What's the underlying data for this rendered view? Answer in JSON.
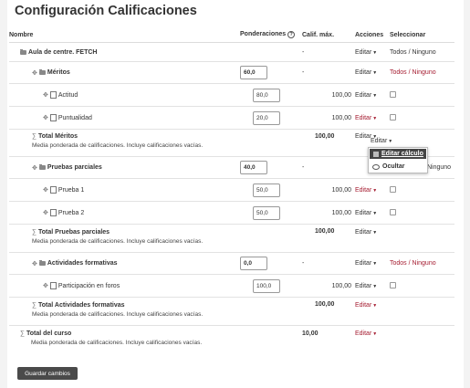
{
  "page": {
    "title": "Configuración Calificaciones"
  },
  "headers": {
    "name": "Nombre",
    "weight": "Ponderaciones",
    "max": "Calif. máx.",
    "actions": "Acciones",
    "select": "Seleccionar"
  },
  "rows": {
    "course": {
      "name": "Aula de centre. FETCH",
      "max": "-",
      "action": "Editar",
      "select_all": "Todos",
      "select_sep": " / ",
      "select_none": "Ninguno"
    },
    "meritos": {
      "name": "Méritos",
      "weight": "60,0",
      "max": "-",
      "action": "Editar",
      "select_all": "Todos",
      "select_sep": " / ",
      "select_none": "Ninguno"
    },
    "actitud": {
      "name": "Actitud",
      "weight": "80,0",
      "max": "100,00",
      "action": "Editar"
    },
    "puntualidad": {
      "name": "Puntualidad",
      "weight": "20,0",
      "max": "100,00",
      "action": "Editar"
    },
    "total_meritos": {
      "name": "Total Méritos",
      "desc": "Media ponderada de calificaciones. Incluye calificaciones vacías.",
      "max": "100,00",
      "action": "Editar"
    },
    "pruebas": {
      "name": "Pruebas parciales",
      "weight": "40,0",
      "max": "-",
      "action": "Editar",
      "select_partial": "Ninguno"
    },
    "prueba1": {
      "name": "Prueba 1",
      "weight": "50,0",
      "max": "100,00",
      "action": "Editar"
    },
    "prueba2": {
      "name": "Prueba 2",
      "weight": "50,0",
      "max": "100,00",
      "action": "Editar"
    },
    "total_pruebas": {
      "name": "Total Pruebas parciales",
      "desc": "Media ponderada de calificaciones. Incluye calificaciones vacías.",
      "max": "100,00",
      "action": "Editar"
    },
    "actividades": {
      "name": "Actividades formativas",
      "weight": "0,0",
      "max": "-",
      "action": "Editar",
      "select_all": "Todos",
      "select_sep": " / ",
      "select_none": "Ninguno"
    },
    "participacion": {
      "name": "Participación en foros",
      "weight": "100,0",
      "max": "100,00",
      "action": "Editar"
    },
    "total_actividades": {
      "name": "Total Actividades formativas",
      "desc": "Media ponderada de calificaciones. Incluye calificaciones vacías.",
      "max": "100,00",
      "action": "Editar"
    },
    "total_curso": {
      "name": "Total del curso",
      "desc": "Media ponderada de calificaciones. Incluye calificaciones vacías.",
      "max": "10,00",
      "action": "Editar"
    }
  },
  "menu": {
    "edit_calc": "Editar cálculo",
    "hide": "Ocultar"
  },
  "buttons": {
    "save": "Guardar cambios"
  },
  "colors": {
    "accent": "#a51c30",
    "button": "#4a4a4a"
  }
}
